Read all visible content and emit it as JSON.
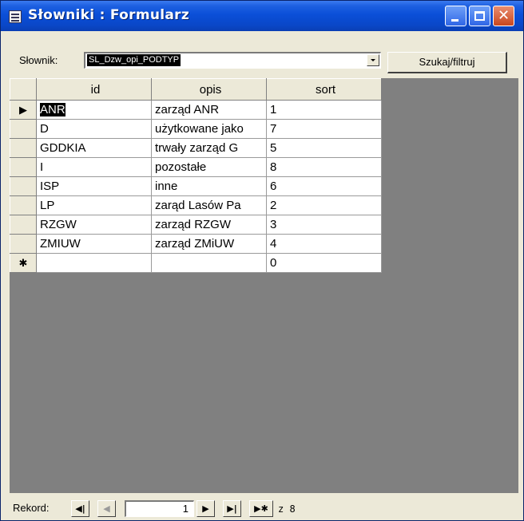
{
  "window": {
    "title": "Słowniki : Formularz",
    "icons": {
      "app": "form-icon",
      "minimize": "minimize-icon",
      "maximize": "maximize-icon",
      "close": "close-icon",
      "close_glyph": "✕"
    }
  },
  "toolbar": {
    "dictionary_label": "Słownik:",
    "dictionary_value": "SL_Dzw_opi_PODTYP",
    "search_button": "Szukaj/filtruj"
  },
  "datasheet": {
    "columns": [
      "id",
      "opis",
      "sort"
    ],
    "rows": [
      {
        "id": "ANR",
        "opis": "zarząd ANR",
        "sort": "1",
        "indicator": "▶"
      },
      {
        "id": "D",
        "opis": "użytkowane jako",
        "sort": "7",
        "indicator": ""
      },
      {
        "id": "GDDKIA",
        "opis": "trwały zarząd G",
        "sort": "5",
        "indicator": ""
      },
      {
        "id": "I",
        "opis": "pozostałe",
        "sort": "8",
        "indicator": ""
      },
      {
        "id": "ISP",
        "opis": "inne",
        "sort": "6",
        "indicator": ""
      },
      {
        "id": "LP",
        "opis": "zarąd Lasów Pa",
        "sort": "2",
        "indicator": ""
      },
      {
        "id": "RZGW",
        "opis": "zarząd RZGW",
        "sort": "3",
        "indicator": ""
      },
      {
        "id": "ZMIUW",
        "opis": "zarząd ZMiUW",
        "sort": "4",
        "indicator": ""
      }
    ],
    "new_row": {
      "indicator": "✱",
      "id": "",
      "opis": "",
      "sort": "0"
    }
  },
  "navigation": {
    "label": "Rekord:",
    "current": "1",
    "total_text": "z 8",
    "buttons": {
      "first": "◀|",
      "prev": "◀",
      "next": "▶",
      "last": "▶|",
      "new": "▶✱"
    }
  }
}
